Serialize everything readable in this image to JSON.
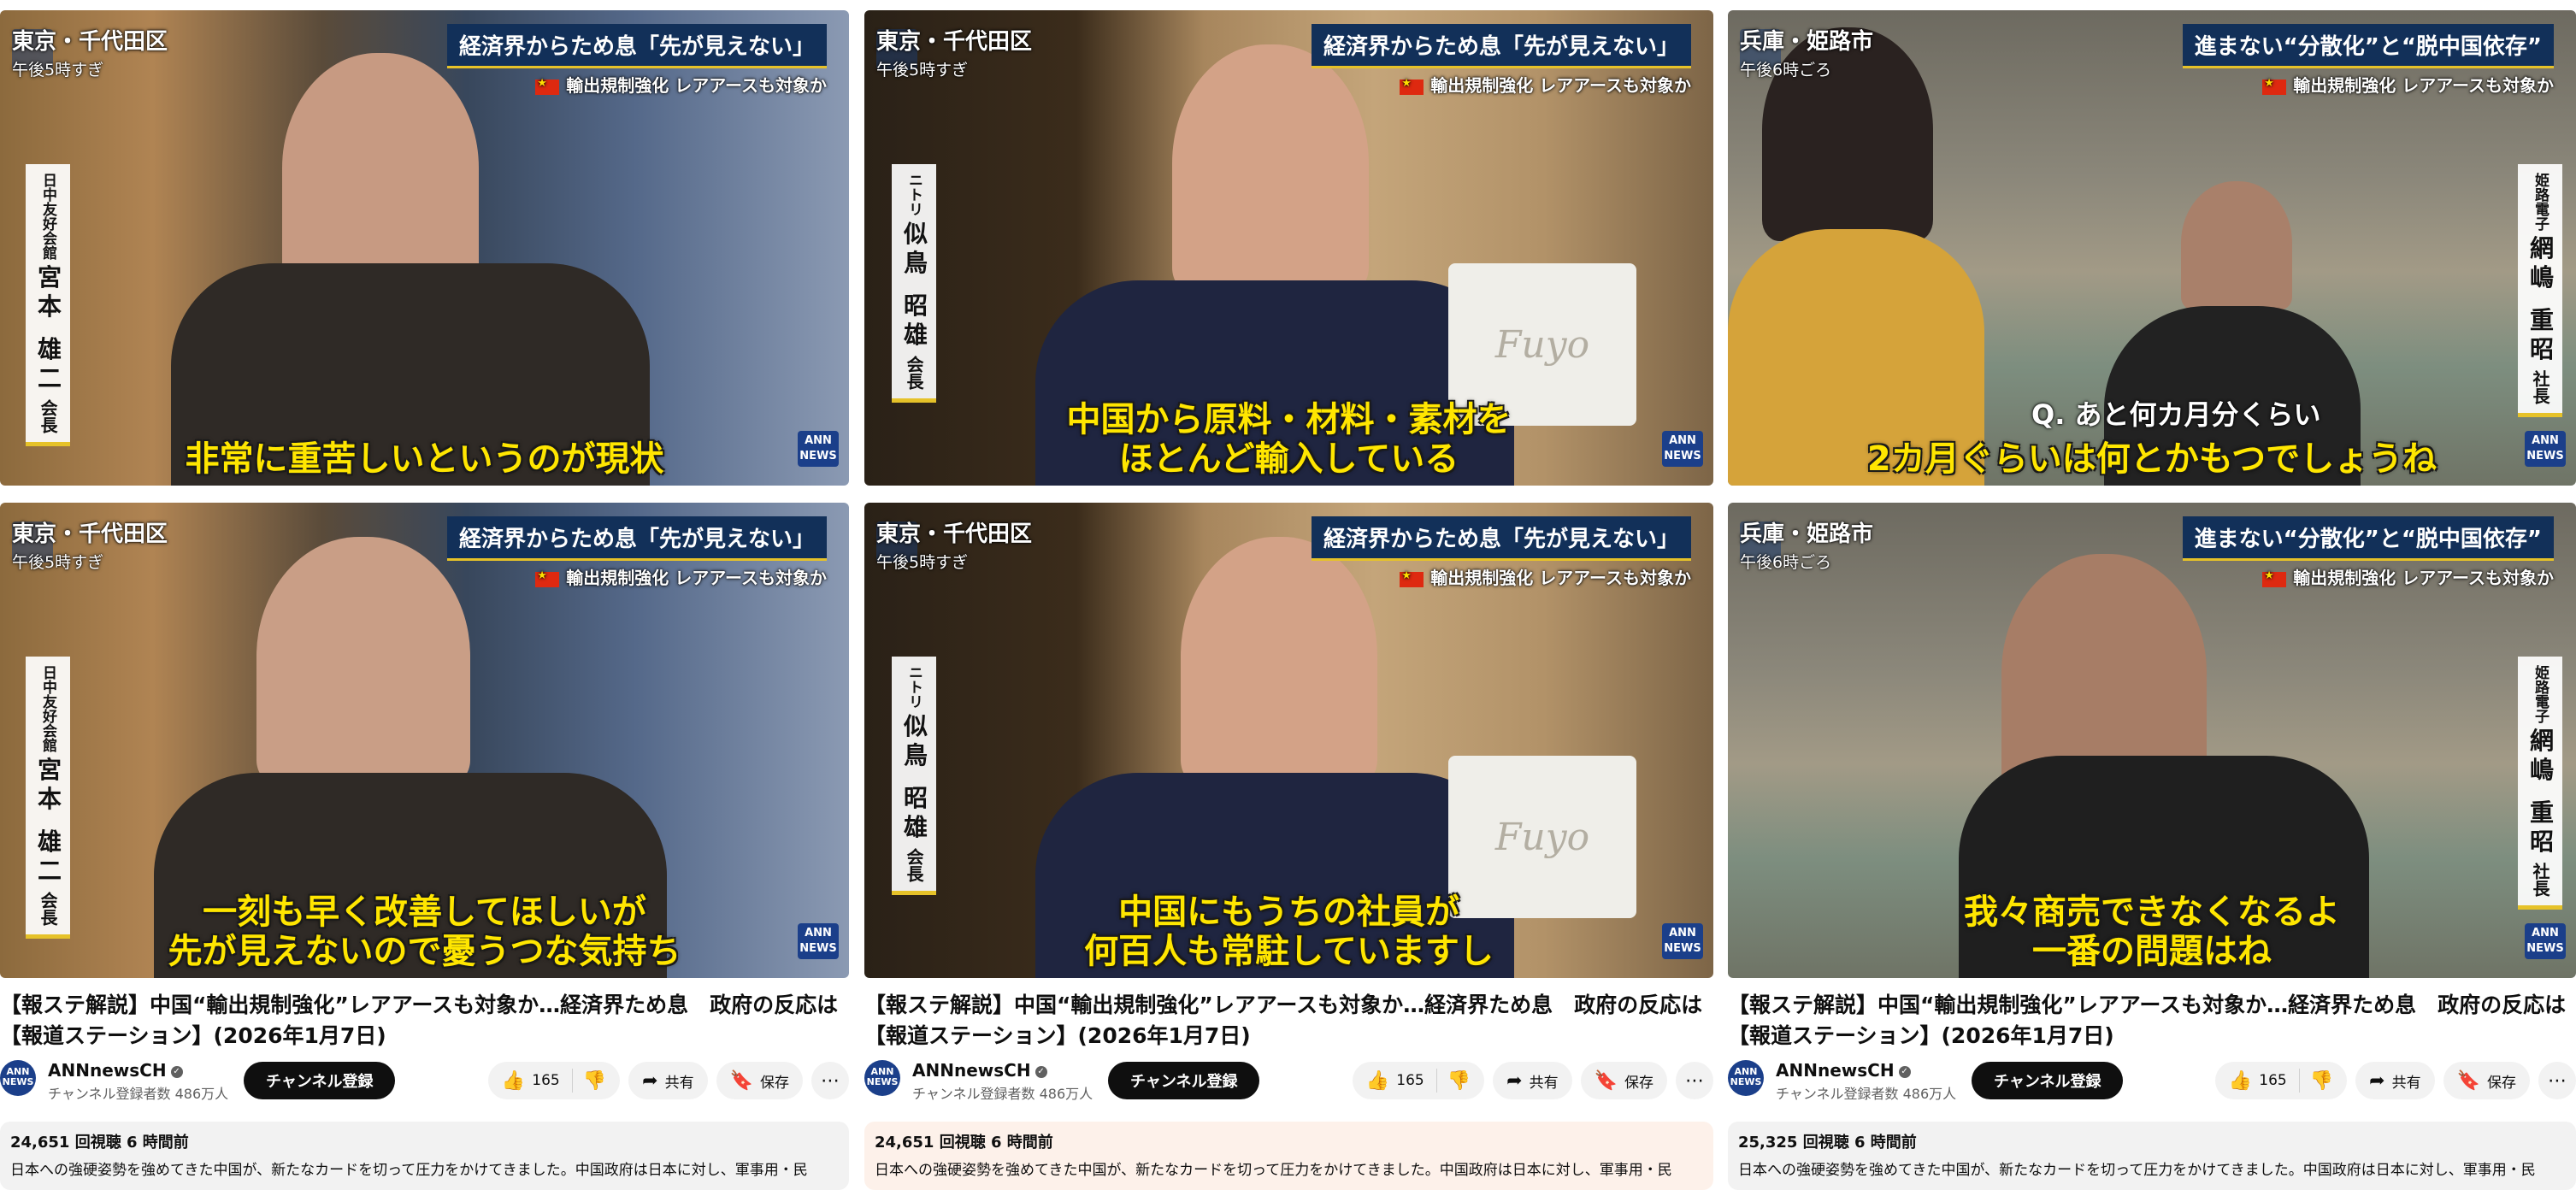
{
  "video_title": "【報ステ解説】中国“輸出規制強化”レアアースも対象か…経済界ため息　政府の反応は【報道ステーション】(2026年1月7日)",
  "channel": {
    "name": "ANNnewsCH",
    "subscribers": "チャンネル登録者数 486万人",
    "avatar_text": "ANN NEWS",
    "subscribe_label": "チャンネル登録"
  },
  "actions": {
    "like_count": "165",
    "share_label": "共有",
    "save_label": "保存"
  },
  "description_text": "日本への強硬姿勢を強めてきた中国が、新たなカードを切って圧力をかけてきました。中国政府は日本に対し、軍事用・民",
  "ann_logo": "ANN NEWS",
  "panels": [
    {
      "views": "24,651 回視聴  6 時間前",
      "frames": [
        {
          "location": "東京・千代田区",
          "time": "午後5時すぎ",
          "headline": "経済界からため息「先が見えない」",
          "subheadline": "輸出規制強化 レアアースも対象か",
          "name_org": "日中友好会館",
          "name": "宮本 雄二",
          "name_title": "会長",
          "caption": "非常に重苦しいというのが現状"
        },
        {
          "location": "東京・千代田区",
          "time": "午後5時すぎ",
          "headline": "経済界からため息「先が見えない」",
          "subheadline": "輸出規制強化 レアアースも対象か",
          "name_org": "日中友好会館",
          "name": "宮本 雄二",
          "name_title": "会長",
          "caption": "一刻も早く改善してほしいが\n先が見えないので憂うつな気持ち"
        }
      ]
    },
    {
      "views": "24,651 回視聴  6 時間前",
      "frames": [
        {
          "location": "東京・千代田区",
          "time": "午後5時すぎ",
          "headline": "経済界からため息「先が見えない」",
          "subheadline": "輸出規制強化 レアアースも対象か",
          "name_org": "ニトリ",
          "name": "似鳥 昭雄",
          "name_title": "会長",
          "caption": "中国から原料・材料・素材を\nほとんど輸入している"
        },
        {
          "location": "東京・千代田区",
          "time": "午後5時すぎ",
          "headline": "経済界からため息「先が見えない」",
          "subheadline": "輸出規制強化 レアアースも対象か",
          "name_org": "ニトリ",
          "name": "似鳥 昭雄",
          "name_title": "会長",
          "caption": "中国にもうちの社員が\n何百人も常駐していますし"
        }
      ]
    },
    {
      "views": "25,325 回視聴  6 時間前",
      "frames": [
        {
          "location": "兵庫・姫路市",
          "time": "午後6時ごろ",
          "headline": "進まない“分散化”と“脱中国依存”",
          "subheadline": "輸出規制強化 レアアースも対象か",
          "name_org": "姫路電子",
          "name": "網嶋 重昭",
          "name_title": "社長",
          "question": "Q. あと何カ月分くらい",
          "caption": "2カ月ぐらいは何とかもつでしょうね"
        },
        {
          "location": "兵庫・姫路市",
          "time": "午後6時ごろ",
          "headline": "進まない“分散化”と“脱中国依存”",
          "subheadline": "輸出規制強化 レアアースも対象か",
          "name_org": "姫路電子",
          "name": "網嶋 重昭",
          "name_title": "社長",
          "caption": "我々商売できなくなるよ\n一番の問題はね"
        }
      ]
    }
  ]
}
